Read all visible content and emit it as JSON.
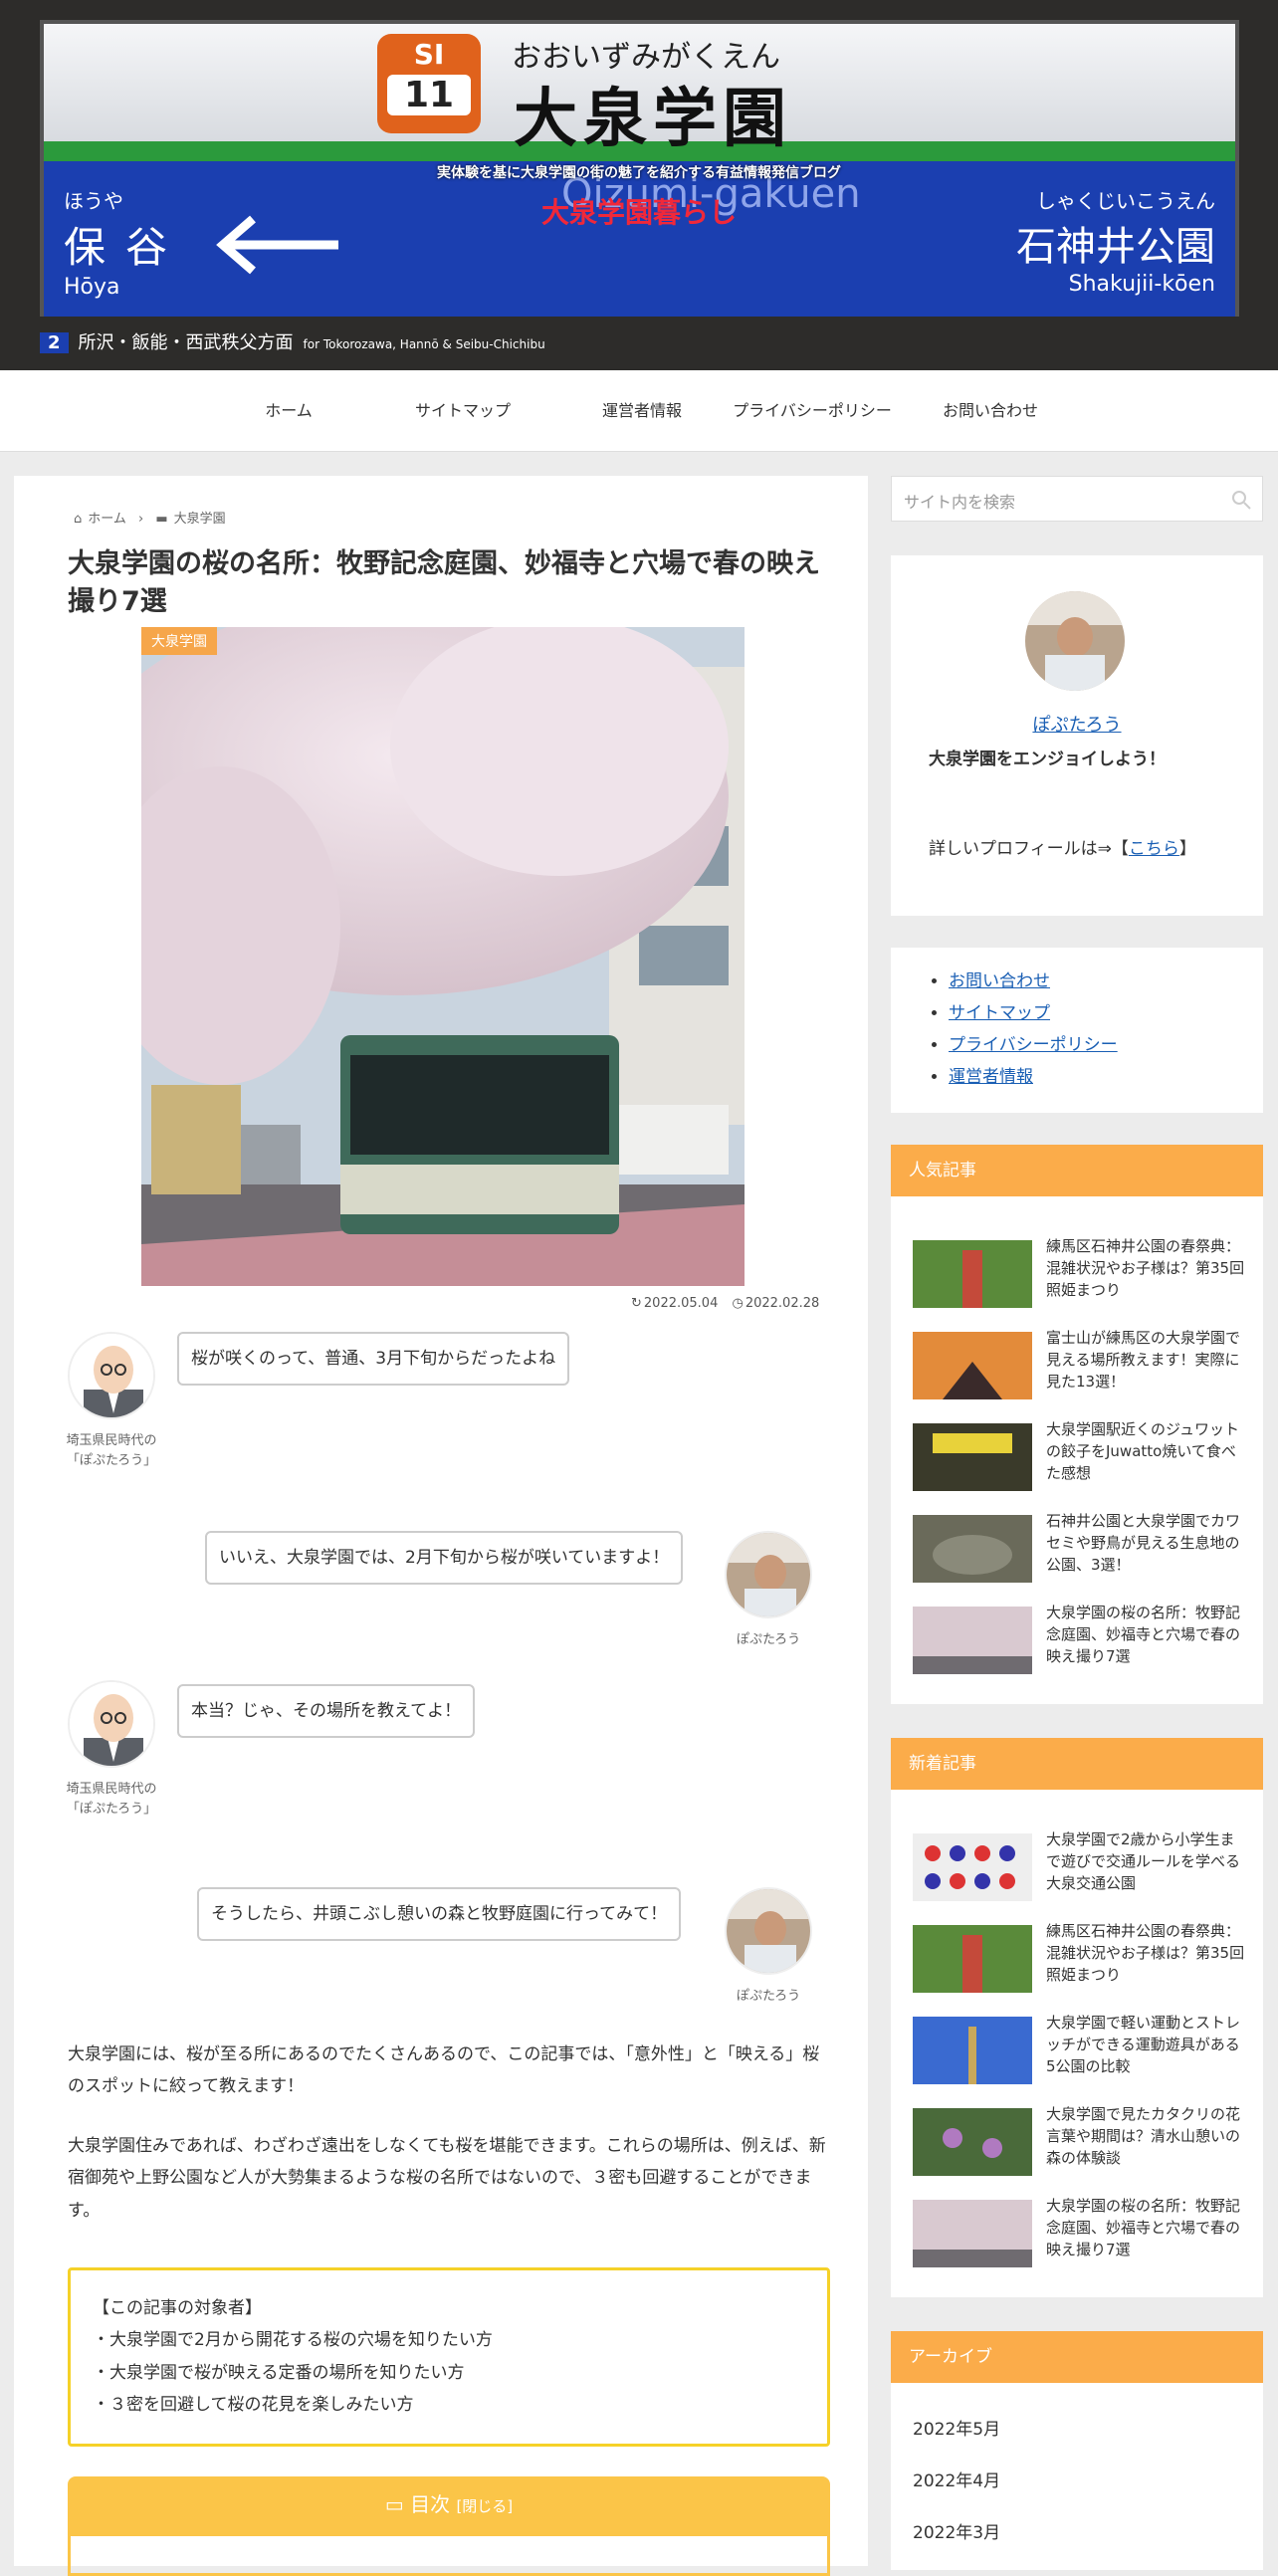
{
  "header": {
    "station_code_letters": "SI",
    "station_code_number": "11",
    "station_kana": "おおいずみがくえん",
    "station_kanji": "大泉学園",
    "station_roman": "Oizumi-gakuen",
    "left_station": {
      "kana": "ほうや",
      "kanji": "保谷",
      "roman": "Hōya"
    },
    "right_station": {
      "kana": "しゃくじいこうえん",
      "kanji": "石神井公園",
      "roman": "Shakujii-kōen"
    },
    "platform_number": "2",
    "direction": "所沢・飯能・西武秩父方面",
    "direction_en": "for Tokorozawa, Hannō & Seibu-Chichibu",
    "tagline": "実体験を基に大泉学園の街の魅了を紹介する有益情報発信ブログ",
    "site_title": "大泉学園暮らし"
  },
  "nav": {
    "items": [
      {
        "label": "ホーム"
      },
      {
        "label": "サイトマップ"
      },
      {
        "label": "運営者情報"
      },
      {
        "label": "プライバシーポリシー"
      },
      {
        "label": "お問い合わせ"
      }
    ]
  },
  "article": {
    "breadcrumb": {
      "home": "ホーム",
      "category": "大泉学園"
    },
    "title": "大泉学園の桜の名所：牧野記念庭園、妙福寺と穴場で春の映え撮り7選",
    "eyecatch_label": "大泉学園",
    "updated": "2022.05.04",
    "published": "2022.02.28",
    "balloons": [
      {
        "speaker": "埼玉県民時代の「ぽぷたろう」",
        "text": "桜が咲くのって、普通、3月下旬からだったよね",
        "side": "left"
      },
      {
        "speaker": "ぽぷたろう",
        "text": "いいえ、大泉学園では、2月下旬から桜が咲いていますよ！",
        "side": "right"
      },
      {
        "speaker": "埼玉県民時代の「ぽぷたろう」",
        "text": "本当？じゃ、その場所を教えてよ！",
        "side": "left"
      },
      {
        "speaker": "ぽぷたろう",
        "text": "そうしたら、井頭こぶし憩いの森と牧野庭園に行ってみて！",
        "side": "right"
      }
    ],
    "para1": "大泉学園には、桜が至る所にあるのでたくさんあるので、この記事では、「意外性」と「映える」桜のスポットに絞って教えます！",
    "para2": "大泉学園住みであれば、わざわざ遠出をしなくても桜を堪能できます。これらの場所は、例えば、新宿御苑や上野公園など人が大勢集まるような桜の名所ではないので、３密も回避することができます。",
    "target_box": [
      "【この記事の対象者】",
      "・大泉学園で2月から開花する桜の穴場を知りたい方",
      "・大泉学園で桜が映える定番の場所を知りたい方",
      "・３密を回避して桜の花見を楽しみたい方"
    ],
    "toc_title": "目次",
    "toc_toggle": "[閉じる]"
  },
  "sidebar": {
    "search_placeholder": "サイト内を検索",
    "profile": {
      "name": "ぽぷたろう",
      "tagline": "大泉学園をエンジョイしよう！",
      "more_prefix": "詳しいプロフィールは⇒【",
      "more_link": "こちら",
      "more_suffix": "】"
    },
    "links": [
      "お問い合わせ",
      "サイトマップ",
      "プライバシーポリシー",
      "運営者情報"
    ],
    "popular": {
      "heading": "人気記事",
      "items": [
        "練馬区石神井公園の春祭典：混雑状況やお子様は？第35回照姫まつり",
        "富士山が練馬区の大泉学園で見える場所教えます！実際に見た13選！",
        "大泉学園駅近くのジュワットの餃子をJuwatto焼いて食べた感想",
        "石神井公園と大泉学園でカワセミや野鳥が見える生息地の公園、3選！",
        "大泉学園の桜の名所：牧野記念庭園、妙福寺と穴場で春の映え撮り7選"
      ]
    },
    "recent": {
      "heading": "新着記事",
      "items": [
        "大泉学園で2歳から小学生まで遊びで交通ルールを学べる大泉交通公園",
        "練馬区石神井公園の春祭典：混雑状況やお子様は？第35回照姫まつり",
        "大泉学園で軽い運動とストレッチができる運動遊具がある5公園の比較",
        "大泉学園で見たカタクリの花言葉や期間は？清水山憩いの森の体験談",
        "大泉学園の桜の名所：牧野記念庭園、妙福寺と穴場で春の映え撮り7選"
      ]
    },
    "archive": {
      "heading": "アーカイブ",
      "items": [
        "2022年5月",
        "2022年4月",
        "2022年3月"
      ]
    }
  }
}
